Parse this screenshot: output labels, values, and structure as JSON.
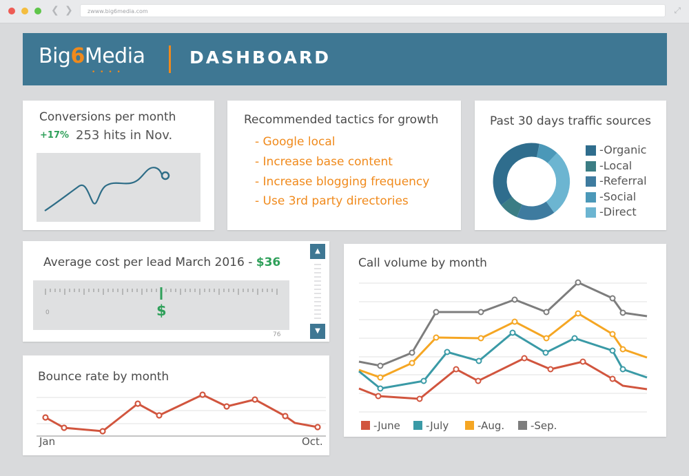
{
  "browser": {
    "url": "zwww.big6media.com"
  },
  "header": {
    "logo_prefix": "Big",
    "logo_six": "6",
    "logo_suffix": "Media",
    "logo_dots": "• • • •",
    "title": "DASHBOARD"
  },
  "conversions": {
    "title": "Conversions per month",
    "change": "+17%",
    "hits": "253 hits in Nov."
  },
  "tactics": {
    "title": "Recommended tactics for growth",
    "items": [
      "- Google local",
      "- Increase base content",
      "- Increase blogging frequency",
      "- Use 3rd party directories"
    ]
  },
  "traffic": {
    "title": "Past 30 days traffic sources",
    "sources": [
      {
        "label": "-Organic",
        "color": "#2f6d8d"
      },
      {
        "label": "-Local",
        "color": "#3b7d84"
      },
      {
        "label": "-Referral",
        "color": "#3e7b9f"
      },
      {
        "label": "-Social",
        "color": "#4b98b8"
      },
      {
        "label": "-Direct",
        "color": "#6cb5d1"
      }
    ]
  },
  "cost": {
    "title": "Average cost per lead March 2016 - ",
    "value": "$36",
    "symbol": "$",
    "min": "0",
    "max": "76",
    "scroll_up": "▲",
    "scroll_down": "▼"
  },
  "bounce": {
    "title": "Bounce rate by month",
    "x_start": "Jan",
    "x_end": "Oct."
  },
  "calls": {
    "title": "Call volume by month",
    "series": [
      {
        "name": "-June",
        "color": "#d1553e"
      },
      {
        "name": "-July",
        "color": "#3a9aa6"
      },
      {
        "name": "-Aug.",
        "color": "#f5a623"
      },
      {
        "name": "-Sep.",
        "color": "#7d7d7d"
      }
    ]
  }
}
